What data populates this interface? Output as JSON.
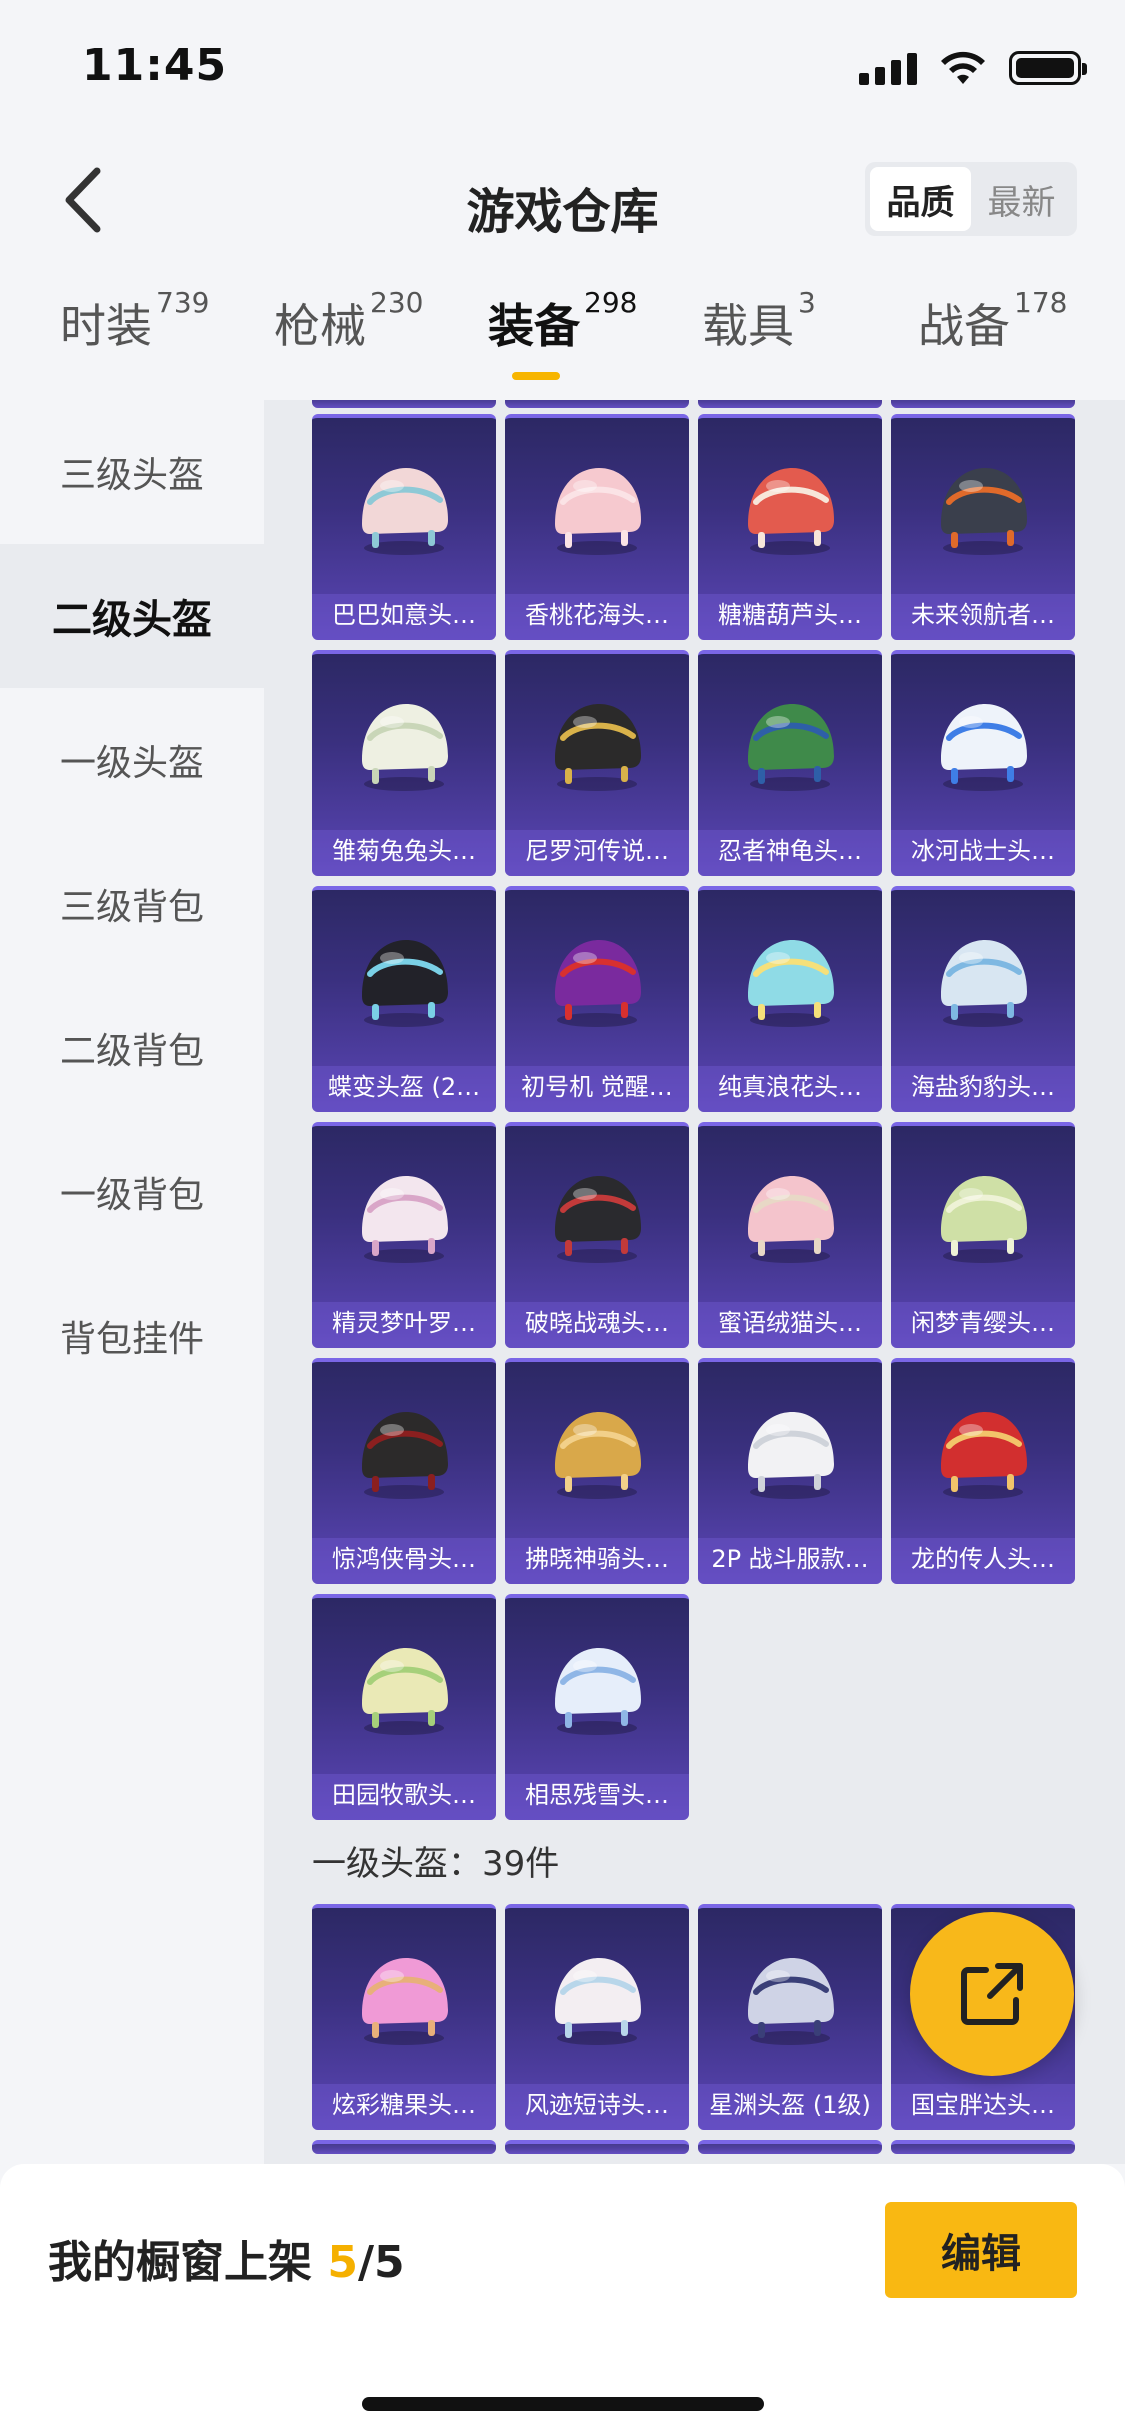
{
  "status": {
    "time": "11:45"
  },
  "header": {
    "title": "游戏仓库",
    "sort_options": [
      {
        "label": "品质",
        "active": true
      },
      {
        "label": "最新",
        "active": false
      }
    ]
  },
  "tabs": [
    {
      "label": "时装",
      "count": "739",
      "active": false
    },
    {
      "label": "枪械",
      "count": "230",
      "active": false
    },
    {
      "label": "装备",
      "count": "298",
      "active": true
    },
    {
      "label": "载具",
      "count": "3",
      "active": false
    },
    {
      "label": "战备",
      "count": "178",
      "active": false
    }
  ],
  "sidebar": {
    "items": [
      {
        "label": "三级头盔",
        "active": false
      },
      {
        "label": "二级头盔",
        "active": true
      },
      {
        "label": "一级头盔",
        "active": false
      },
      {
        "label": "三级背包",
        "active": false
      },
      {
        "label": "二级背包",
        "active": false
      },
      {
        "label": "一级背包",
        "active": false
      },
      {
        "label": "背包挂件",
        "active": false
      }
    ]
  },
  "level2_items": [
    {
      "name": "巴巴如意头…",
      "color": "#f2d7d7",
      "accent": "#8ec9d6"
    },
    {
      "name": "香桃花海头…",
      "color": "#f6c9cf",
      "accent": "#fbe3e6"
    },
    {
      "name": "糖糖葫芦头…",
      "color": "#e35b4e",
      "accent": "#f7e6d9"
    },
    {
      "name": "未来领航者…",
      "color": "#3a3f4c",
      "accent": "#e06a2a"
    },
    {
      "name": "雏菊兔兔头…",
      "color": "#eef0e2",
      "accent": "#c9d6b8"
    },
    {
      "name": "尼罗河传说…",
      "color": "#2b2a2a",
      "accent": "#d9b24a"
    },
    {
      "name": "忍者神龟头…",
      "color": "#3f8a4a",
      "accent": "#2e5fa8"
    },
    {
      "name": "冰河战士头…",
      "color": "#eef3fa",
      "accent": "#3f7ee6"
    },
    {
      "name": "蝶变头盔 (2…",
      "color": "#222229",
      "accent": "#7ad0e6"
    },
    {
      "name": "初号机 觉醒…",
      "color": "#7a2a9e",
      "accent": "#d8302f"
    },
    {
      "name": "纯真浪花头…",
      "color": "#8fdbe6",
      "accent": "#f5e07a"
    },
    {
      "name": "海盐豹豹头…",
      "color": "#d8e6f2",
      "accent": "#7eb8e2"
    },
    {
      "name": "精灵梦叶罗…",
      "color": "#f3e6ee",
      "accent": "#d9a6c8"
    },
    {
      "name": "破晓战魂头…",
      "color": "#2a2a2e",
      "accent": "#c23a3a"
    },
    {
      "name": "蜜语绒猫头…",
      "color": "#f4c4cc",
      "accent": "#e8d8c6"
    },
    {
      "name": "闲梦青缨头…",
      "color": "#cfe0a6",
      "accent": "#eef2d6"
    },
    {
      "name": "惊鸿侠骨头…",
      "color": "#2c2a2a",
      "accent": "#8b1f1f"
    },
    {
      "name": "拂晓神骑头…",
      "color": "#d9a84a",
      "accent": "#f2d08a"
    },
    {
      "name": "2P 战斗服款…",
      "color": "#f2f2f4",
      "accent": "#cfd3da"
    },
    {
      "name": "龙的传人头…",
      "color": "#d22f2f",
      "accent": "#f2c46a"
    },
    {
      "name": "田园牧歌头…",
      "color": "#eae9b6",
      "accent": "#a6d07a"
    },
    {
      "name": "相思残雪头…",
      "color": "#e6eefa",
      "accent": "#8fb6e6"
    }
  ],
  "level1_section": {
    "heading": "一级头盔：39件"
  },
  "level1_items": [
    {
      "name": "炫彩糖果头…",
      "color": "#f09ad6",
      "accent": "#e8b07a"
    },
    {
      "name": "风迹短诗头…",
      "color": "#f3eef2",
      "accent": "#b8d6ea"
    },
    {
      "name": "星渊头盔 (1级)",
      "color": "#cfd3e6",
      "accent": "#3a3f78"
    },
    {
      "name": "国宝胖达头…",
      "color": "#f2f2f2",
      "accent": "#222"
    }
  ],
  "showcase": {
    "label_prefix": "我的橱窗上架 ",
    "current": "5",
    "total_suffix": "/5"
  },
  "edit_button": {
    "label": "编辑"
  },
  "colors": {
    "accent": "#f7b500",
    "card_top": "#2c2864",
    "card_bottom": "#5b46b6"
  }
}
